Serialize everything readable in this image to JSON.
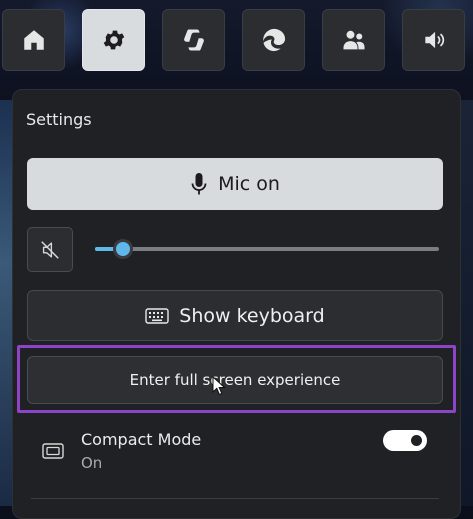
{
  "top_tiles": [
    {
      "icon": "home-icon",
      "active": false
    },
    {
      "icon": "gear-icon",
      "active": true
    },
    {
      "icon": "copilot-icon",
      "active": false
    },
    {
      "icon": "edge-icon",
      "active": false
    },
    {
      "icon": "people-icon",
      "active": false
    },
    {
      "icon": "volume-icon",
      "active": false
    }
  ],
  "panel": {
    "title": "Settings",
    "mic_button_label": "Mic on",
    "volume_level": 0.08,
    "keyboard_button_label": "Show keyboard",
    "fullscreen_button_label": "Enter full screen experience",
    "compact_mode": {
      "label": "Compact Mode",
      "state": "On",
      "enabled": true
    }
  },
  "colors": {
    "accent": "#60b8ea",
    "highlight": "#8e44c6",
    "panel_bg": "#202124",
    "active_tile": "#d9dcdf"
  }
}
